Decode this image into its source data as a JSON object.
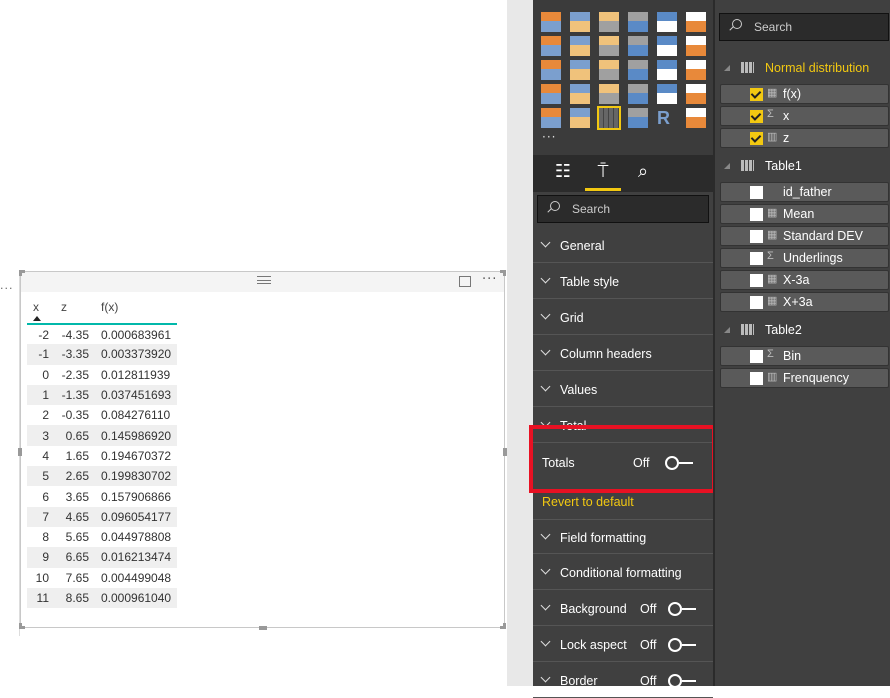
{
  "table_visual": {
    "columns": [
      "x",
      "z",
      "f(x)"
    ],
    "sort_column": "x",
    "sort_direction": "ascending",
    "header_line_color": "#01b8aa",
    "rows": [
      [
        "-2",
        "-4.35",
        "0.000683961"
      ],
      [
        "-1",
        "-3.35",
        "0.003373920"
      ],
      [
        "0",
        "-2.35",
        "0.012811939"
      ],
      [
        "1",
        "-1.35",
        "0.037451693"
      ],
      [
        "2",
        "-0.35",
        "0.084276110"
      ],
      [
        "3",
        "0.65",
        "0.145986920"
      ],
      [
        "4",
        "1.65",
        "0.194670372"
      ],
      [
        "5",
        "2.65",
        "0.199830702"
      ],
      [
        "6",
        "3.65",
        "0.157906866"
      ],
      [
        "7",
        "4.65",
        "0.096054177"
      ],
      [
        "8",
        "5.65",
        "0.044978808"
      ],
      [
        "9",
        "6.65",
        "0.016213474"
      ],
      [
        "10",
        "7.65",
        "0.004499048"
      ],
      [
        "11",
        "8.65",
        "0.000961040"
      ]
    ],
    "more_options": "···"
  },
  "visualizations": {
    "icons": [
      "stacked-bar-icon",
      "stacked-column-icon",
      "clustered-bar-icon",
      "clustered-column-icon",
      "100-stacked-bar-icon",
      "100-stacked-column-icon",
      "line-chart-icon",
      "area-chart-icon",
      "stacked-area-icon",
      "line-clustered-column-icon",
      "line-stacked-column-icon",
      "ribbon-chart-icon",
      "waterfall-icon",
      "scatter-icon",
      "pie-chart-icon",
      "donut-chart-icon",
      "treemap-icon",
      "map-icon",
      "filled-map-icon",
      "shape-map-icon",
      "funnel-icon",
      "gauge-icon",
      "card-icon",
      "multi-row-card-icon",
      "kpi-icon",
      "slicer-icon",
      "table-icon",
      "matrix-icon",
      "r-visual-icon",
      "arcgis-icon"
    ],
    "selected": "table-icon",
    "more": "···",
    "format_tabs": [
      "fields-tab",
      "format-tab",
      "analytics-tab"
    ],
    "active_tab": "format-tab",
    "search_placeholder": "Search",
    "sections": [
      "General",
      "Table style",
      "Grid",
      "Column headers",
      "Values",
      "Total"
    ],
    "totals": {
      "label": "Totals",
      "state": "Off"
    },
    "revert": "Revert to default",
    "sections2": [
      {
        "label": "Field formatting"
      },
      {
        "label": "Conditional formatting"
      },
      {
        "label": "Background",
        "state": "Off"
      },
      {
        "label": "Lock aspect",
        "state": "Off"
      },
      {
        "label": "Border",
        "state": "Off"
      }
    ],
    "accent_color": "#f2c811",
    "highlight_color": "#e81123"
  },
  "fields": {
    "search_placeholder": "Search",
    "tables": [
      {
        "name": "Normal distribution",
        "highlighted": true,
        "fields": [
          {
            "name": "f(x)",
            "checked": true,
            "icon": "calculator-icon"
          },
          {
            "name": "x",
            "checked": true,
            "icon": "sigma-icon"
          },
          {
            "name": "z",
            "checked": true,
            "icon": "calculated-column-icon"
          }
        ]
      },
      {
        "name": "Table1",
        "fields": [
          {
            "name": "id_father",
            "checked": false,
            "icon": ""
          },
          {
            "name": "Mean",
            "checked": false,
            "icon": "calculator-icon"
          },
          {
            "name": "Standard DEV",
            "checked": false,
            "icon": "calculator-icon"
          },
          {
            "name": "Underlings",
            "checked": false,
            "icon": "sigma-icon"
          },
          {
            "name": "X-3a",
            "checked": false,
            "icon": "calculator-icon"
          },
          {
            "name": "X+3a",
            "checked": false,
            "icon": "calculator-icon"
          }
        ]
      },
      {
        "name": "Table2",
        "fields": [
          {
            "name": "Bin",
            "checked": false,
            "icon": "sigma-icon"
          },
          {
            "name": "Frenquency",
            "checked": false,
            "icon": "calculated-column-icon"
          }
        ]
      }
    ]
  }
}
